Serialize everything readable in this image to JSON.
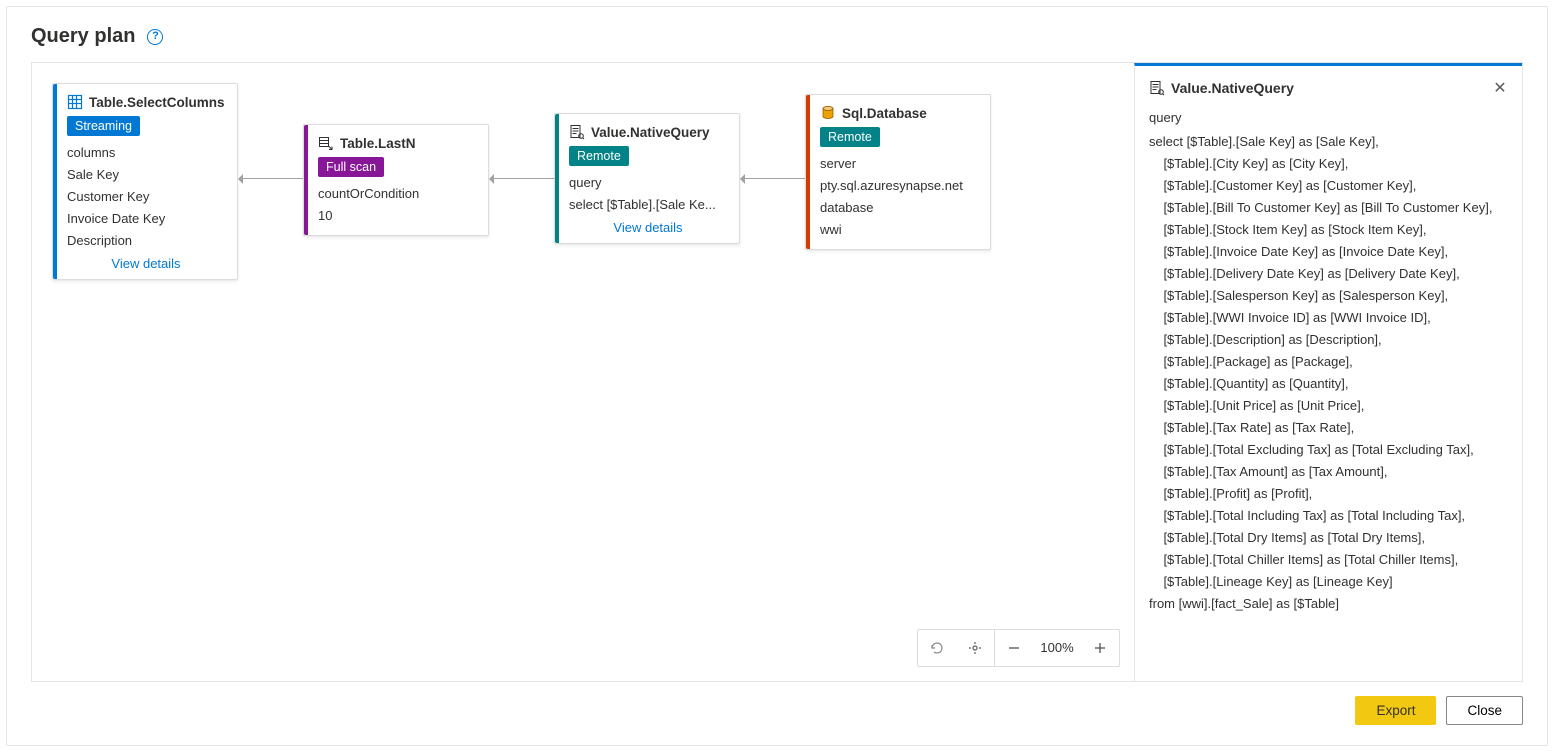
{
  "title": "Query plan",
  "nodes": {
    "n1": {
      "title": "Table.SelectColumns",
      "badge": "Streaming",
      "label": "columns",
      "items": [
        "Sale Key",
        "Customer Key",
        "Invoice Date Key",
        "Description"
      ],
      "viewDetails": "View details"
    },
    "n2": {
      "title": "Table.LastN",
      "badge": "Full scan",
      "label": "countOrCondition",
      "value": "10"
    },
    "n3": {
      "title": "Value.NativeQuery",
      "badge": "Remote",
      "label": "query",
      "value": "select [$Table].[Sale Ke...",
      "viewDetails": "View details"
    },
    "n4": {
      "title": "Sql.Database",
      "badge": "Remote",
      "label1": "server",
      "value1": "pty.sql.azuresynapse.net",
      "label2": "database",
      "value2": "wwi"
    }
  },
  "panel": {
    "title": "Value.NativeQuery",
    "label": "query",
    "sql": "select [$Table].[Sale Key] as [Sale Key],\n    [$Table].[City Key] as [City Key],\n    [$Table].[Customer Key] as [Customer Key],\n    [$Table].[Bill To Customer Key] as [Bill To Customer Key],\n    [$Table].[Stock Item Key] as [Stock Item Key],\n    [$Table].[Invoice Date Key] as [Invoice Date Key],\n    [$Table].[Delivery Date Key] as [Delivery Date Key],\n    [$Table].[Salesperson Key] as [Salesperson Key],\n    [$Table].[WWI Invoice ID] as [WWI Invoice ID],\n    [$Table].[Description] as [Description],\n    [$Table].[Package] as [Package],\n    [$Table].[Quantity] as [Quantity],\n    [$Table].[Unit Price] as [Unit Price],\n    [$Table].[Tax Rate] as [Tax Rate],\n    [$Table].[Total Excluding Tax] as [Total Excluding Tax],\n    [$Table].[Tax Amount] as [Tax Amount],\n    [$Table].[Profit] as [Profit],\n    [$Table].[Total Including Tax] as [Total Including Tax],\n    [$Table].[Total Dry Items] as [Total Dry Items],\n    [$Table].[Total Chiller Items] as [Total Chiller Items],\n    [$Table].[Lineage Key] as [Lineage Key]\nfrom [wwi].[fact_Sale] as [$Table]"
  },
  "zoom": "100%",
  "buttons": {
    "export": "Export",
    "close": "Close"
  }
}
